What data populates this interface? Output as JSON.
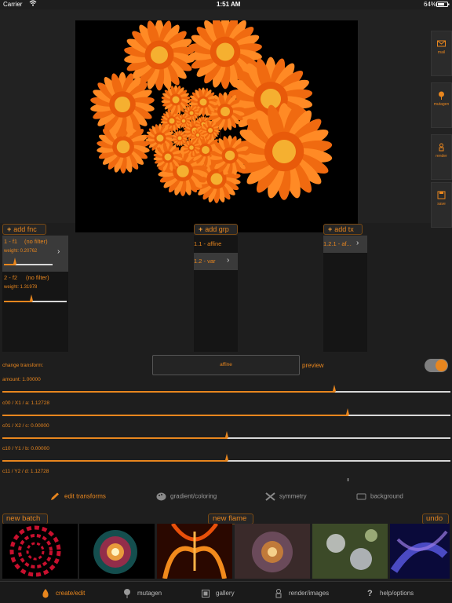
{
  "status": {
    "carrier": "Carrier",
    "time": "1:51 AM",
    "battery": "64%"
  },
  "canvas": {
    "name": "fractal-flame-preview"
  },
  "side_buttons": [
    {
      "label": "mail",
      "icon": "mail-icon"
    },
    {
      "label": "mutagen",
      "icon": "tree-icon"
    },
    {
      "label": "render",
      "icon": "render-icon"
    },
    {
      "label": "save",
      "icon": "save-icon"
    }
  ],
  "editor": {
    "add_fnc": "add fnc",
    "add_grp": "add grp",
    "add_tx": "add tx",
    "functions": [
      {
        "name": "1 - f1",
        "filter": "(no filter)",
        "weight_label": "weight: 0.20762",
        "weight_fraction": 0.23
      },
      {
        "name": "2 - f2",
        "filter": "(no filter)",
        "weight_label": "weight: 1.31978",
        "weight_fraction": 0.44
      }
    ],
    "groups": [
      {
        "label": "1.1 - affine"
      },
      {
        "label": "1.2 - var"
      }
    ],
    "transforms": [
      {
        "label": "1.2.1 - af..."
      }
    ]
  },
  "transform": {
    "change_label": "change transform:",
    "selected": "affine",
    "preview_label": "preview",
    "preview_on": true,
    "sliders": [
      {
        "label": "amount: 1.00000",
        "fraction": 0.74
      },
      {
        "label": "c00 / X1 / a: 1.12728",
        "fraction": 0.77
      },
      {
        "label": "c01 / X2 / c: 0.00000",
        "fraction": 0.5
      },
      {
        "label": "c10 / Y1 / b: 0.00000",
        "fraction": 0.5
      },
      {
        "label": "c11 / Y2 / d: 1.12728",
        "fraction": 0.77
      }
    ]
  },
  "modes": [
    {
      "label": "edit transforms",
      "icon": "pencil-icon",
      "active": true
    },
    {
      "label": "gradient/coloring",
      "icon": "palette-icon",
      "active": false
    },
    {
      "label": "symmetry",
      "icon": "symmetry-icon",
      "active": false
    },
    {
      "label": "background",
      "icon": "background-icon",
      "active": false
    }
  ],
  "batch": {
    "new_batch": "new batch",
    "new_flame": "new flame",
    "undo": "undo"
  },
  "tabs": [
    {
      "label": "create/edit",
      "icon": "flame-icon",
      "active": true
    },
    {
      "label": "mutagen",
      "icon": "tree-icon",
      "active": false
    },
    {
      "label": "gallery",
      "icon": "gallery-icon",
      "active": false
    },
    {
      "label": "render/images",
      "icon": "render-icon",
      "active": false
    },
    {
      "label": "help/options",
      "icon": "help-icon",
      "active": false
    }
  ],
  "colors": {
    "accent": "#e8861e",
    "background": "#1e1e1e",
    "panel": "#151515"
  }
}
